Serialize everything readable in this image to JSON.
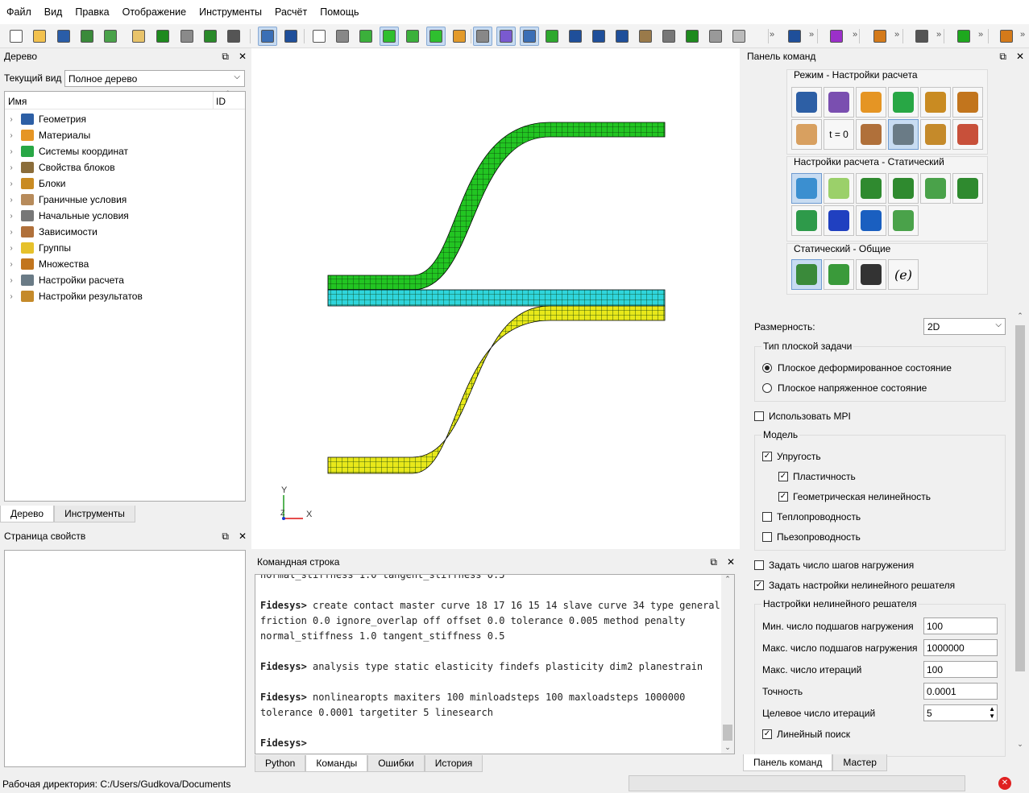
{
  "menu": [
    "Файл",
    "Вид",
    "Правка",
    "Отображение",
    "Инструменты",
    "Расчёт",
    "Помощь"
  ],
  "tree_panel": {
    "title": "Дерево",
    "current_view_label": "Текущий вид",
    "current_view_value": "Полное дерево",
    "col_name": "Имя",
    "col_id": "ID",
    "items": [
      {
        "label": "Геометрия",
        "icon": "geometry-icon",
        "color": "#2d5fa5"
      },
      {
        "label": "Материалы",
        "icon": "materials-icon",
        "color": "#e59524"
      },
      {
        "label": "Системы координат",
        "icon": "coordinate-systems-icon",
        "color": "#28a745"
      },
      {
        "label": "Свойства блоков",
        "icon": "block-properties-icon",
        "color": "#8b6d3a"
      },
      {
        "label": "Блоки",
        "icon": "blocks-icon",
        "color": "#c98b22"
      },
      {
        "label": "Граничные условия",
        "icon": "boundary-conditions-icon",
        "color": "#b78b5b"
      },
      {
        "label": "Начальные условия",
        "icon": "initial-conditions-icon",
        "color": "#777777"
      },
      {
        "label": "Зависимости",
        "icon": "dependencies-icon",
        "color": "#b0703a"
      },
      {
        "label": "Группы",
        "icon": "groups-icon",
        "color": "#e6c12b"
      },
      {
        "label": "Множества",
        "icon": "sets-icon",
        "color": "#c2751d"
      },
      {
        "label": "Настройки расчета",
        "icon": "analysis-settings-icon",
        "color": "#6a7b86"
      },
      {
        "label": "Настройки результатов",
        "icon": "results-settings-icon",
        "color": "#c58a2a"
      }
    ],
    "tabs": [
      "Дерево",
      "Инструменты"
    ]
  },
  "properties_panel": {
    "title": "Страница свойств"
  },
  "viewport": {
    "axis_y": "Y",
    "axis_x": "X",
    "axis_z": "Z",
    "mesh": [
      {
        "name": "upper-strip",
        "color": "#22c522"
      },
      {
        "name": "middle-strip",
        "color": "#2fd5dc"
      },
      {
        "name": "lower-strip",
        "color": "#e8e81a"
      }
    ]
  },
  "command_line": {
    "title": "Командная строка",
    "lines": [
      {
        "prompt": "",
        "text": "normal_stiffness 1.0 tangent_stiffness 0.5"
      },
      {
        "prompt": "",
        "text": ""
      },
      {
        "prompt": "Fidesys>",
        "text": " create contact master curve 18 17 16 15 14 slave curve 34 type general"
      },
      {
        "prompt": "",
        "text": "friction 0.0 ignore_overlap off offset 0.0 tolerance 0.005 method penalty"
      },
      {
        "prompt": "",
        "text": "normal_stiffness 1.0 tangent_stiffness 0.5"
      },
      {
        "prompt": "",
        "text": ""
      },
      {
        "prompt": "Fidesys>",
        "text": " analysis type static elasticity findefs plasticity dim2 planestrain"
      },
      {
        "prompt": "",
        "text": ""
      },
      {
        "prompt": "Fidesys>",
        "text": " nonlinearopts maxiters 100 minloadsteps 100 maxloadsteps 1000000"
      },
      {
        "prompt": "",
        "text": "tolerance 0.0001 targetiter 5 linesearch"
      },
      {
        "prompt": "",
        "text": ""
      },
      {
        "prompt": "Fidesys>",
        "text": ""
      }
    ],
    "tabs": [
      "Python",
      "Команды",
      "Ошибки",
      "История"
    ]
  },
  "command_panel": {
    "title": "Панель команд",
    "group1_title": "Режим - Настройки расчета",
    "group2_title": "Настройки расчета - Статический",
    "group3_title": "Статический - Общие",
    "icon_t0": "t = 0",
    "icon_e": "(e)",
    "dimension_label": "Размерность:",
    "dimension_value": "2D",
    "plane_task_title": "Тип плоской задачи",
    "plane_strain": "Плоское деформированное состояние",
    "plane_stress": "Плоское напряженное состояние",
    "use_mpi": "Использовать MPI",
    "model_title": "Модель",
    "elasticity": "Упругость",
    "plasticity": "Пластичность",
    "geom_nonlin": "Геометрическая нелинейность",
    "heat": "Теплопроводность",
    "piezo": "Пьезопроводность",
    "set_steps": "Задать число шагов нагружения",
    "set_solver": "Задать настройки нелинейного решателя",
    "solver_title": "Настройки нелинейного решателя",
    "min_steps_label": "Мин. число подшагов нагружения",
    "min_steps_value": "100",
    "max_steps_label": "Макс. число подшагов нагружения",
    "max_steps_value": "1000000",
    "max_iter_label": "Макс. число итераций",
    "max_iter_value": "100",
    "accuracy_label": "Точность",
    "accuracy_value": "0.0001",
    "target_iter_label": "Целевое число итераций",
    "target_iter_value": "5",
    "line_search": "Линейный поиск",
    "tabs": [
      "Панель команд",
      "Мастер"
    ]
  },
  "status": {
    "workdir": "Рабочая директория: C:/Users/Gudkova/Documents"
  }
}
